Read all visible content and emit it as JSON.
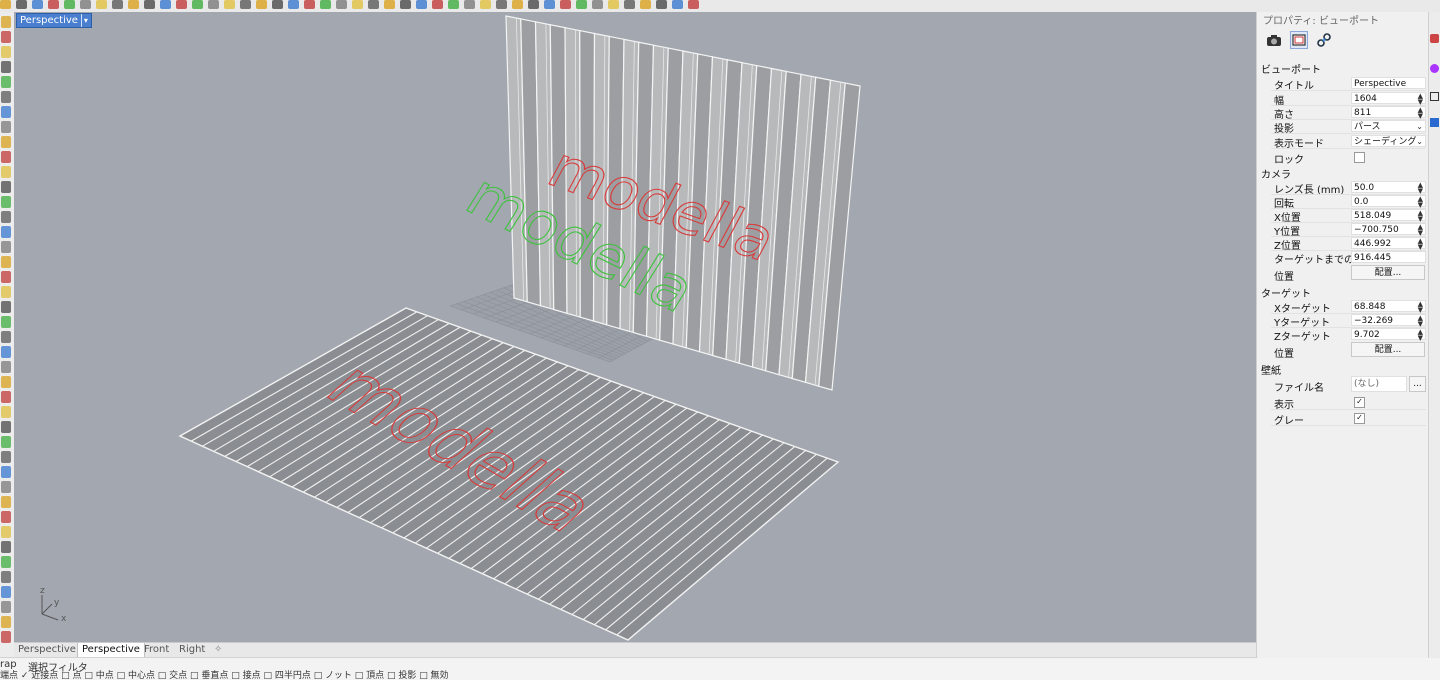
{
  "viewport": {
    "title": "Perspective",
    "axis": {
      "x": "x",
      "y": "y",
      "z": "z"
    },
    "text_objects": [
      {
        "text": "modella",
        "color": "#d93a3a"
      },
      {
        "text": "modella",
        "color": "#3ec23e"
      },
      {
        "text": "modella",
        "color": "#d93a3a"
      }
    ]
  },
  "tabs": [
    {
      "label": "Perspective",
      "active": false
    },
    {
      "label": "Perspective",
      "active": true
    },
    {
      "label": "Front",
      "active": false
    },
    {
      "label": "Right",
      "active": false
    }
  ],
  "add_tab_icon": "plus-icon",
  "statusbar": {
    "osnap_label": "rap",
    "filter_label": "選択フィルタ",
    "osnap_items": "端点  ✓ 近接点  □ 点  □ 中点  □ 中心点  □ 交点  □ 垂直点  □ 接点  □ 四半円点  □ ノット  □ 頂点  □ 投影  □ 無効"
  },
  "panel": {
    "title": "プロパティ: ビューポート",
    "buttons": [
      "camera-icon",
      "viewport-icon",
      "link-icon"
    ],
    "viewport_section": "ビューポート",
    "title_label": "タイトル",
    "title_value": "Perspective",
    "width_label": "幅",
    "width_value": "1604",
    "height_label": "高さ",
    "height_value": "811",
    "projection_label": "投影",
    "projection_value": "パース",
    "display_label": "表示モード",
    "display_value": "シェーディング",
    "lock_label": "ロック",
    "camera_section": "カメラ",
    "lens_label": "レンズ長 (mm)",
    "lens_value": "50.0",
    "rotation_label": "回転",
    "rotation_value": "0.0",
    "xpos_label": "X位置",
    "xpos_value": "518.049",
    "ypos_label": "Y位置",
    "ypos_value": "−700.750",
    "zpos_label": "Z位置",
    "zpos_value": "446.992",
    "target_dist_label": "ターゲットまでの距離",
    "target_dist_value": "916.445",
    "position_label": "位置",
    "place_button": "配置...",
    "target_section": "ターゲット",
    "xtarget_label": "Xターゲット",
    "xtarget_value": "68.848",
    "ytarget_label": "Yターゲット",
    "ytarget_value": "−32.269",
    "ztarget_label": "Zターゲット",
    "ztarget_value": "9.702",
    "target_position_label": "位置",
    "target_place_button": "配置...",
    "wallpaper_section": "壁紙",
    "filename_label": "ファイル名",
    "filename_value": "(なし)",
    "browse_button": "...",
    "show_label": "表示",
    "gray_label": "グレー",
    "check_mark": "✓"
  }
}
